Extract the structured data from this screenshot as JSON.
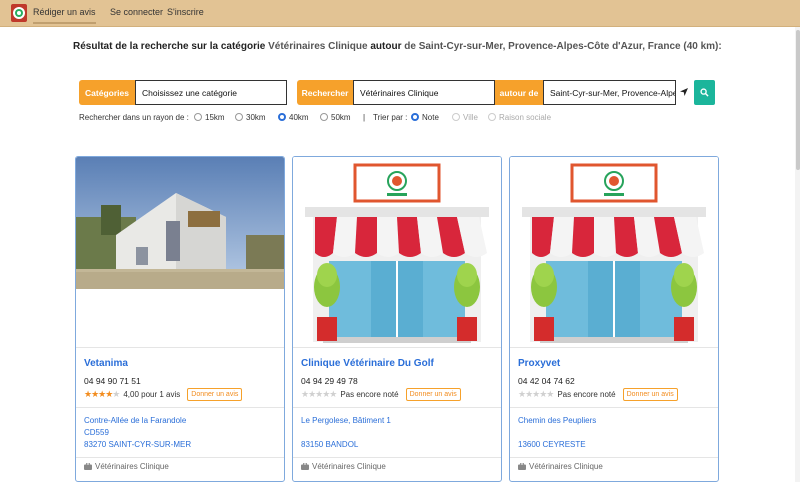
{
  "nav": {
    "items": [
      {
        "label": "Rédiger un avis",
        "active": true
      },
      {
        "label": "Se connecter",
        "active": false
      },
      {
        "label": "S'inscrire",
        "active": false
      }
    ]
  },
  "results": {
    "prefix": "Résultat de la recherche sur la catégorie",
    "category": "Vétérinaires Clinique",
    "around": "autour",
    "location_text": "de Saint-Cyr-sur-Mer, Provence-Alpes-Côte d'Azur, France (40 km):"
  },
  "search": {
    "categories_label": "Catégories",
    "categories_value": "Choisissez une catégorie",
    "search_label": "Rechercher",
    "search_value": "Vétérinaires Clinique",
    "around_label": "autour de",
    "around_value": "Saint-Cyr-sur-Mer, Provence-Alpes"
  },
  "options": {
    "radius_label": "Rechercher dans un rayon de :",
    "radius": [
      {
        "label": "15km",
        "selected": false
      },
      {
        "label": "30km",
        "selected": false
      },
      {
        "label": "40km",
        "selected": true
      },
      {
        "label": "50km",
        "selected": false
      }
    ],
    "separator": "|",
    "sort_label": "Trier par :",
    "sort": [
      {
        "label": "Note",
        "selected": true,
        "disabled": false
      },
      {
        "label": "Ville",
        "selected": false,
        "disabled": true
      },
      {
        "label": "Raison sociale",
        "selected": false,
        "disabled": true
      }
    ]
  },
  "cards": [
    {
      "name": "Vetanima",
      "phone": "04 94 90 71 51",
      "stars_filled": 4,
      "rating_text": "4,00 pour 1 avis",
      "review_button": "Donner un avis",
      "address": [
        "Contre-Allée de la Farandole",
        "CD559",
        "83270 SAINT-CYR-SUR-MER"
      ],
      "category": "Vétérinaires Clinique",
      "image": "photo"
    },
    {
      "name": "Clinique Vétérinaire Du Golf",
      "phone": "04 94 29 49 78",
      "stars_filled": 0,
      "rating_text": "Pas encore noté",
      "review_button": "Donner un avis",
      "address": [
        "Le Pergolese, Bâtiment 1",
        "",
        "83150 BANDOL"
      ],
      "category": "Vétérinaires Clinique",
      "image": "storefront"
    },
    {
      "name": "Proxyvet",
      "phone": "04 42 04 74 62",
      "stars_filled": 0,
      "rating_text": "Pas encore noté",
      "review_button": "Donner un avis",
      "address": [
        "Chemin des Peupliers",
        "",
        "13600 CEYRESTE"
      ],
      "category": "Vétérinaires Clinique",
      "image": "storefront"
    }
  ],
  "colors": {
    "topbar": "#e2c394",
    "accent_orange": "#f6a12b",
    "link_blue": "#2a6ed8",
    "go_button": "#1bb59b",
    "card_border": "#7fa9dd"
  }
}
